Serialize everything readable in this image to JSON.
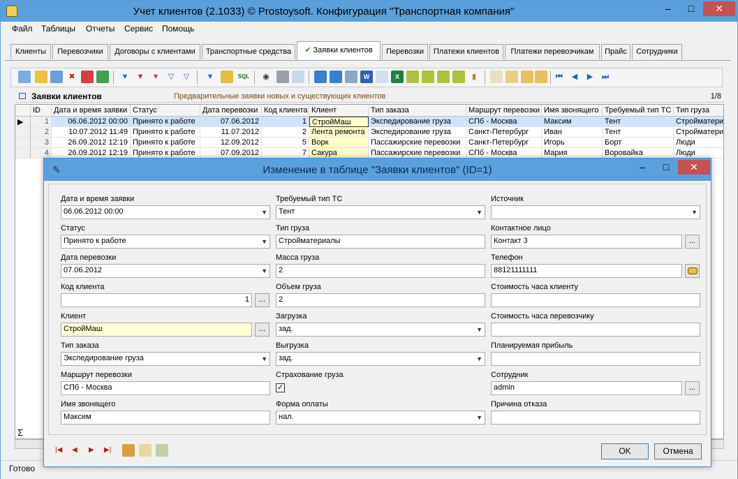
{
  "window": {
    "title": "Учет клиентов (2.1033) © Prostoysoft. Конфигурация \"Транспортная компания\""
  },
  "menu": [
    "Файл",
    "Таблицы",
    "Отчеты",
    "Сервис",
    "Помощь"
  ],
  "tabs": [
    "Клиенты",
    "Перевозчики",
    "Договоры с клиентами",
    "Транспортные средства",
    "Заявки клиентов",
    "Перевозки",
    "Платежи клиентов",
    "Платежи перевозчикам",
    "Прайс",
    "Сотрудники"
  ],
  "active_tab": "Заявки клиентов",
  "grid": {
    "title": "Заявки клиентов",
    "subtitle": "Предварительные заявки новых и существующих клиентов",
    "counter": "1/8",
    "columns": [
      "ID",
      "Дата и время заявки",
      "Статус",
      "Дата перевозки",
      "Код клиента",
      "Клиент",
      "Тип заказа",
      "Маршрут перевозки",
      "Имя звонящего",
      "Требуемый тип ТС",
      "Тип груза"
    ],
    "rows": [
      [
        "1",
        "06.06.2012 00:00",
        "Принято к работе",
        "07.06.2012",
        "1",
        "СтройМаш",
        "Экспедирование груза",
        "СПб - Москва",
        "Максим",
        "Тент",
        "Стройматериалы"
      ],
      [
        "2",
        "10.07.2012 11:49",
        "Принято к работе",
        "11.07.2012",
        "2",
        "Лента ремонта",
        "Экспедирование груза",
        "Санкт-Петербург",
        "Иван",
        "Тент",
        "Стройматериалы"
      ],
      [
        "3",
        "26.09.2012 12:19",
        "Принято к работе",
        "12.09.2012",
        "5",
        "Ворк",
        "Пассажирские перевозки",
        "Санкт-Петербург",
        "Игорь",
        "Борт",
        "Люди"
      ],
      [
        "4",
        "26.09.2012 12:19",
        "Принято к работе",
        "07.09.2012",
        "7",
        "Сакура",
        "Пассажирские перевозки",
        "СПб - Москва",
        "Мария",
        "Воровайка",
        "Люди"
      ]
    ],
    "sigma": "Σ"
  },
  "status": {
    "text": "Готово"
  },
  "dialog": {
    "title": "Изменение в таблице \"Заявки клиентов\" (ID=1)",
    "fields": {
      "request_datetime": {
        "label": "Дата и время заявки",
        "value": "06.06.2012 00:00"
      },
      "status": {
        "label": "Статус",
        "value": "Принято к работе"
      },
      "transport_date": {
        "label": "Дата перевозки",
        "value": "07.06.2012"
      },
      "client_code": {
        "label": "Код клиента",
        "value": "1"
      },
      "client": {
        "label": "Клиент",
        "value": "СтройМаш"
      },
      "order_type": {
        "label": "Тип заказа",
        "value": "Экспедирование груза"
      },
      "route": {
        "label": "Маршрут перевозки",
        "value": "СПб - Москва"
      },
      "caller_name": {
        "label": "Имя звонящего",
        "value": "Максим"
      },
      "vehicle_type": {
        "label": "Требуемый тип ТС",
        "value": "Тент"
      },
      "cargo_type": {
        "label": "Тип груза",
        "value": "Стройматериалы"
      },
      "cargo_mass": {
        "label": "Масса груза",
        "value": "2"
      },
      "cargo_volume": {
        "label": "Объем груза",
        "value": "2"
      },
      "loading": {
        "label": "Загрузка",
        "value": "зад."
      },
      "unloading": {
        "label": "Выгрузка",
        "value": "зад."
      },
      "insurance": {
        "label": "Страхование груза",
        "checked": true,
        "mark": "✓"
      },
      "payment_form": {
        "label": "Форма оплаты",
        "value": "нал."
      },
      "source": {
        "label": "Источник",
        "value": ""
      },
      "contact_person": {
        "label": "Контактное лицо",
        "value": "Контакт 3"
      },
      "phone": {
        "label": "Телефон",
        "value": "88121111111"
      },
      "client_hour_cost": {
        "label": "Стоимость часа клиенту",
        "value": ""
      },
      "carrier_hour_cost": {
        "label": "Стоимость часа перевозчику",
        "value": ""
      },
      "planned_profit": {
        "label": "Планируемая прибыль",
        "value": ""
      },
      "employee": {
        "label": "Сотрудник",
        "value": "admin"
      },
      "reject_reason": {
        "label": "Причина отказа",
        "value": ""
      }
    },
    "ellipsis": "...",
    "buttons": {
      "ok": "OK",
      "cancel": "Отмена"
    }
  },
  "colors": {
    "titlebar": "#5aa0dc",
    "selected_row": "#cfe3fb",
    "client_highlight": "#ffffcc",
    "close_button": "#c75050"
  }
}
